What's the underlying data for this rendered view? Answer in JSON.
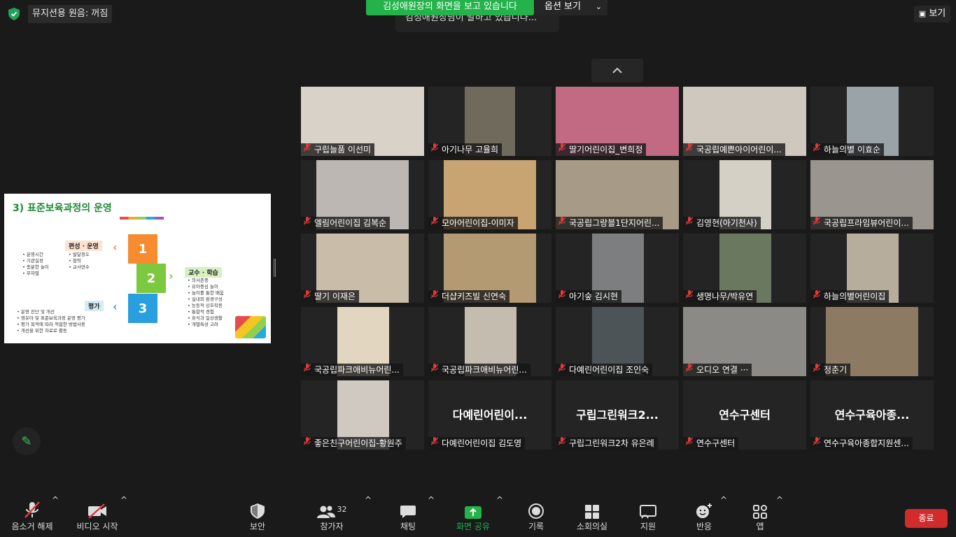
{
  "top": {
    "music_mode": "뮤지션용 원음: 꺼짐",
    "share_banner": "김성애원장의 화면을 보고 있습니다",
    "view_options": "옵션 보기",
    "speaking": "김성애원장님이 말하고 있습니다...",
    "view_label": "보기"
  },
  "slide": {
    "title": "3) 표준보육과정의 운영",
    "labels": [
      "편성 · 운영",
      "교수 · 학습",
      "평가"
    ],
    "numbers": [
      "1",
      "2",
      "3"
    ],
    "list_a": [
      "운영시간",
      "기관실정",
      "충분한 놀이",
      "무차별"
    ],
    "list_b": [
      "발달정도",
      "협력",
      "교사연수"
    ],
    "list_c": [
      "의사존중",
      "유아중심 놀이",
      "놀이를 통한 배움",
      "실내외 환경구성",
      "능동적 상호작용",
      "통합적 경험",
      "휴식과 일상생활",
      "개별특성 고려"
    ],
    "list_d": [
      "운영 진단 및 개선",
      "영유아 및 표준보육과정 운영 평가",
      "평가 목적에 따라 적합한 방법사용",
      "개선을 위한 자료로 활동"
    ]
  },
  "participants": [
    {
      "name": "구립늘품 이선미",
      "big": ""
    },
    {
      "name": "아기나무 고율희",
      "big": ""
    },
    {
      "name": "딸기어린이집_변희정",
      "big": ""
    },
    {
      "name": "국공립예쁜아이어린이...",
      "big": ""
    },
    {
      "name": "하늘의별 이효순",
      "big": ""
    },
    {
      "name": "엘림어린이집 김복순",
      "big": ""
    },
    {
      "name": "모아어린이집-이미자",
      "big": ""
    },
    {
      "name": "국공립그랑블1단지어린...",
      "big": ""
    },
    {
      "name": "김영현(아기천사)",
      "big": ""
    },
    {
      "name": "국공립프라임뷰어린이...",
      "big": ""
    },
    {
      "name": "딸기 이재은",
      "big": ""
    },
    {
      "name": "더샵키즈빌 신연숙",
      "big": ""
    },
    {
      "name": "아기숲 김시현",
      "big": ""
    },
    {
      "name": "생명나무/박유연",
      "big": ""
    },
    {
      "name": "하늘의별어린이집",
      "big": ""
    },
    {
      "name": "국공립파크애비뉴어린...",
      "big": ""
    },
    {
      "name": "국공립파크애비뉴어린...",
      "big": ""
    },
    {
      "name": "다예린어린이집 조인숙",
      "big": ""
    },
    {
      "name": "오디오 연결 ···",
      "big": ""
    },
    {
      "name": "정춘기",
      "big": ""
    },
    {
      "name": "좋은친구어린이집-황원주",
      "big": ""
    },
    {
      "name": "다예린어린이집 김도영",
      "big": "다예린어린이..."
    },
    {
      "name": "구립그린워크2차 유은례",
      "big": "구립그린워크2..."
    },
    {
      "name": "연수구센터",
      "big": "연수구센터"
    },
    {
      "name": "연수구육아종합지원센...",
      "big": "연수구육아종..."
    }
  ],
  "toolbar": {
    "mute": "음소거 해제",
    "video": "비디오 시작",
    "security": "보안",
    "participants": "참가자",
    "participants_count": "32",
    "chat": "채팅",
    "share": "화면 공유",
    "record": "기록",
    "breakout": "소회의실",
    "support": "지원",
    "reactions": "반응",
    "apps": "앱",
    "end": "종료"
  },
  "colors": {
    "accent_green": "#24b24b",
    "end_red": "#d12b2b",
    "muted_red": "#e03a3a"
  }
}
